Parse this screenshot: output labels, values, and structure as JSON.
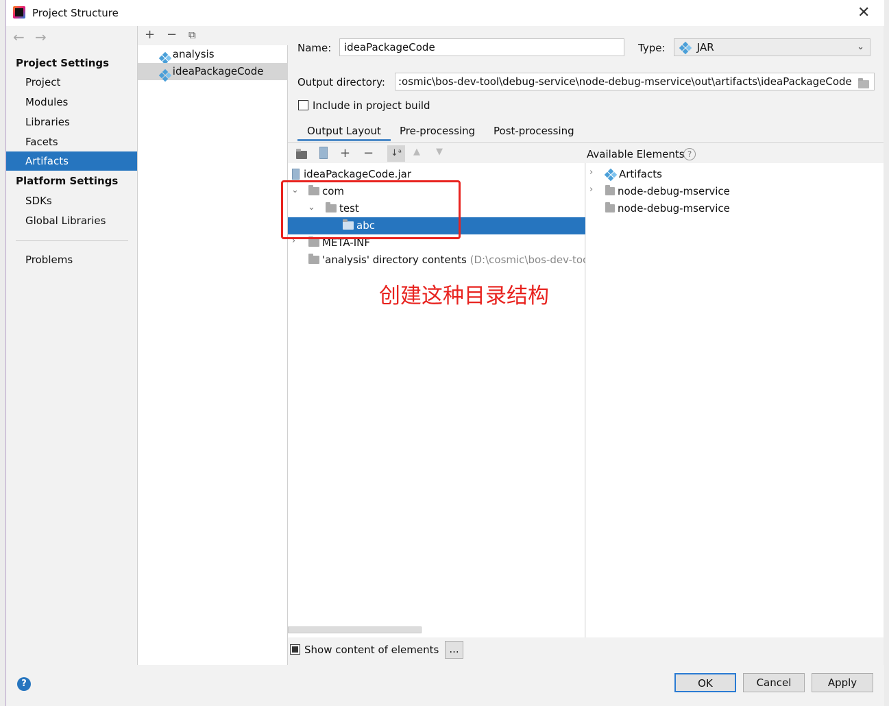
{
  "window": {
    "title": "Project Structure"
  },
  "nav": {
    "project_settings_header": "Project Settings",
    "items": [
      {
        "label": "Project"
      },
      {
        "label": "Modules"
      },
      {
        "label": "Libraries"
      },
      {
        "label": "Facets"
      },
      {
        "label": "Artifacts",
        "selected": true
      }
    ],
    "platform_settings_header": "Platform Settings",
    "platform_items": [
      {
        "label": "SDKs"
      },
      {
        "label": "Global Libraries"
      }
    ],
    "problems": "Problems"
  },
  "artifacts_list": {
    "items": [
      {
        "label": "analysis"
      },
      {
        "label": "ideaPackageCode",
        "selected": true
      }
    ]
  },
  "form": {
    "name_label": "Name:",
    "name_value": "ideaPackageCode",
    "type_label": "Type:",
    "type_value": "JAR",
    "output_dir_label": "Output directory:",
    "output_dir_value": ":osmic\\bos-dev-tool\\debug-service\\node-debug-mservice\\out\\artifacts\\ideaPackageCode",
    "include_label": "Include in project build",
    "include_checked": false
  },
  "tabs": [
    {
      "label": "Output Layout",
      "active": true
    },
    {
      "label": "Pre-processing"
    },
    {
      "label": "Post-processing"
    }
  ],
  "layout_tree": {
    "root": "ideaPackageCode.jar",
    "nodes": [
      {
        "label": "com"
      },
      {
        "label": "test"
      },
      {
        "label": "abc",
        "selected": true
      },
      {
        "label": "META-INF"
      },
      {
        "label": "'analysis' directory contents",
        "detail": "(D:\\cosmic\\bos-dev-tool"
      }
    ]
  },
  "annotation": {
    "text": "创建这种目录结构",
    "color": "#e8231f"
  },
  "available": {
    "title": "Available Elements",
    "items": [
      {
        "label": "Artifacts"
      },
      {
        "label": "node-debug-mservice"
      },
      {
        "label": "node-debug-mservice"
      }
    ]
  },
  "bottom": {
    "show_content_label": "Show content of elements",
    "ellipsis": "...",
    "ok": "OK",
    "cancel": "Cancel",
    "apply": "Apply"
  },
  "colors": {
    "selection": "#2675bf",
    "accent": "#e8231f"
  }
}
